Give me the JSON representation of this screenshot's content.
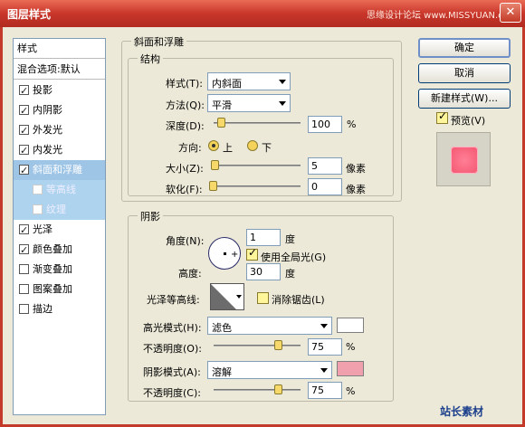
{
  "window": {
    "title": "图层样式",
    "watermark": "思缘设计论坛 www.MISSYUAN.com",
    "close_glyph": "✕"
  },
  "sidebar": {
    "header": "样式",
    "blend_options": "混合选项:默认",
    "items": [
      {
        "label": "投影",
        "checked": true
      },
      {
        "label": "内阴影",
        "checked": true
      },
      {
        "label": "外发光",
        "checked": true
      },
      {
        "label": "内发光",
        "checked": true
      },
      {
        "label": "斜面和浮雕",
        "checked": true,
        "selected": true
      },
      {
        "label": "等高线",
        "checked": false,
        "sub": true
      },
      {
        "label": "纹理",
        "checked": false,
        "sub": true
      },
      {
        "label": "光泽",
        "checked": true
      },
      {
        "label": "颜色叠加",
        "checked": true
      },
      {
        "label": "渐变叠加",
        "checked": false
      },
      {
        "label": "图案叠加",
        "checked": false
      },
      {
        "label": "描边",
        "checked": false
      }
    ]
  },
  "bevel": {
    "section_title": "斜面和浮雕",
    "structure_title": "结构",
    "style_label": "样式(T):",
    "style_value": "内斜面",
    "technique_label": "方法(Q):",
    "technique_value": "平滑",
    "depth_label": "深度(D):",
    "depth_value": "100",
    "depth_unit": "%",
    "direction_label": "方向:",
    "direction_up": "上",
    "direction_down": "下",
    "size_label": "大小(Z):",
    "size_value": "5",
    "size_unit": "像素",
    "soften_label": "软化(F):",
    "soften_value": "0",
    "soften_unit": "像素"
  },
  "shading": {
    "title": "阴影",
    "angle_label": "角度(N):",
    "angle_value": "1",
    "angle_unit": "度",
    "global_light_label": "使用全局光(G)",
    "altitude_label": "高度:",
    "altitude_value": "30",
    "altitude_unit": "度",
    "gloss_label": "光泽等高线:",
    "antialias_label": "消除锯齿(L)",
    "highlight_mode_label": "高光模式(H):",
    "highlight_mode_value": "滤色",
    "highlight_opacity_label": "不透明度(O):",
    "highlight_opacity_value": "75",
    "shadow_mode_label": "阴影模式(A):",
    "shadow_mode_value": "溶解",
    "shadow_opacity_label": "不透明度(C):",
    "shadow_opacity_value": "75",
    "percent": "%"
  },
  "colors": {
    "highlight_color": "#ffffff",
    "shadow_color": "#f0a0ac"
  },
  "buttons": {
    "ok": "确定",
    "cancel": "取消",
    "new_style": "新建样式(W)...",
    "preview": "预览(V)"
  },
  "logo": "站长素材"
}
